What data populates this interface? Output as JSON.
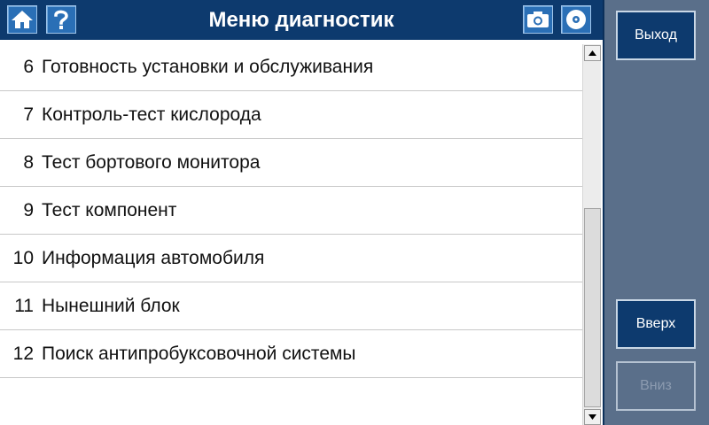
{
  "header": {
    "title": "Меню диагностик",
    "icons": {
      "home": "home-icon",
      "help": "help-icon",
      "camera": "camera-icon",
      "disc": "disc-icon"
    }
  },
  "menu": {
    "items": [
      {
        "num": "6",
        "label": "Готовность установки и обслуживания"
      },
      {
        "num": "7",
        "label": "Контроль-тест кислорода"
      },
      {
        "num": "8",
        "label": "Тест бортового монитора"
      },
      {
        "num": "9",
        "label": "Тест компонент"
      },
      {
        "num": "10",
        "label": "Информация автомобиля"
      },
      {
        "num": "11",
        "label": "Нынешний блок"
      },
      {
        "num": "12",
        "label": "Поиск антипробуксовочной системы"
      }
    ]
  },
  "sidebar": {
    "exit_label": "Выход",
    "up_label": "Вверх",
    "down_label": "Вниз",
    "down_enabled": false
  },
  "colors": {
    "header_bg": "#0d3a6e",
    "panel_bg": "#5a6f8a",
    "icon_button_bg": "#2a6fb6"
  }
}
